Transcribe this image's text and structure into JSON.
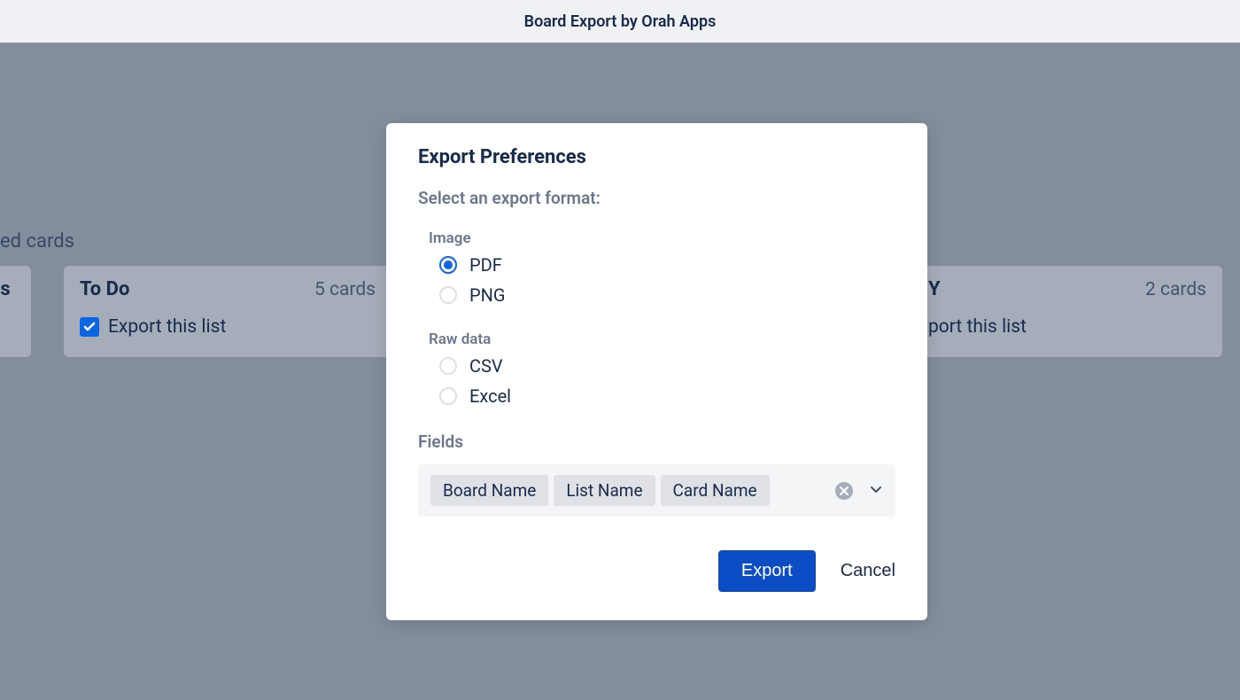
{
  "header": {
    "title": "Board Export by Orah Apps"
  },
  "background": {
    "left_text_fragment": "ed cards",
    "lists": [
      {
        "title_fragment": "ds",
        "count": "",
        "checkbox_label": ""
      },
      {
        "title": "To Do",
        "count": "5 cards",
        "checkbox_label": "Export this list"
      },
      {
        "title_fragment_right": "Y",
        "count": "2 cards",
        "checkbox_label": "port this list"
      }
    ]
  },
  "modal": {
    "title": "Export Preferences",
    "subtitle": "Select an export format:",
    "groups": {
      "image": {
        "label": "Image",
        "options": [
          {
            "label": "PDF",
            "selected": true
          },
          {
            "label": "PNG",
            "selected": false
          }
        ]
      },
      "raw_data": {
        "label": "Raw data",
        "options": [
          {
            "label": "CSV",
            "selected": false
          },
          {
            "label": "Excel",
            "selected": false
          }
        ]
      }
    },
    "fields": {
      "label": "Fields",
      "chips": [
        "Board Name",
        "List Name",
        "Card Name"
      ]
    },
    "buttons": {
      "export": "Export",
      "cancel": "Cancel"
    }
  }
}
